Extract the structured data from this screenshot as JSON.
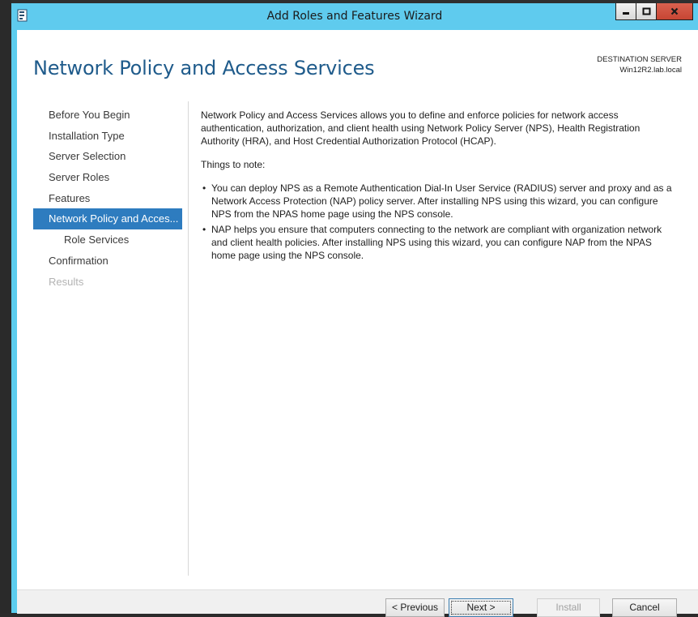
{
  "window": {
    "title": "Add Roles and Features Wizard",
    "buttons": {
      "minimize": "minimize-icon",
      "maximize": "maximize-icon",
      "close": "close-icon"
    }
  },
  "header": {
    "page_title": "Network Policy and Access Services",
    "destination_label": "DESTINATION SERVER",
    "destination_server": "Win12R2.lab.local"
  },
  "nav": {
    "items": [
      {
        "label": "Before You Begin",
        "state": "normal"
      },
      {
        "label": "Installation Type",
        "state": "normal"
      },
      {
        "label": "Server Selection",
        "state": "normal"
      },
      {
        "label": "Server Roles",
        "state": "normal"
      },
      {
        "label": "Features",
        "state": "normal"
      },
      {
        "label": "Network Policy and Acces...",
        "state": "active"
      },
      {
        "label": "Role Services",
        "state": "sub"
      },
      {
        "label": "Confirmation",
        "state": "normal"
      },
      {
        "label": "Results",
        "state": "disabled"
      }
    ]
  },
  "content": {
    "intro": "Network Policy and Access Services allows you to define and enforce policies for network access authentication, authorization, and client health using Network Policy Server (NPS), Health Registration Authority (HRA), and Host Credential Authorization Protocol (HCAP).",
    "notes_heading": "Things to note:",
    "bullet_glyph": "•",
    "bullets": [
      "You can deploy NPS as a Remote Authentication Dial-In User Service (RADIUS) server and proxy and as a Network Access Protection (NAP) policy server. After installing NPS using this wizard, you can configure NPS from the NPAS home page using the NPS console.",
      "NAP helps you ensure that computers connecting to the network are compliant with organization network and client health policies. After installing NPS using this wizard, you can configure NAP from the NPAS home page using the NPS console."
    ]
  },
  "footer": {
    "previous": "< Previous",
    "next": "Next >",
    "install": "Install",
    "cancel": "Cancel"
  },
  "colors": {
    "titlebar": "#5fcbee",
    "title_text": "#1f5b8b",
    "nav_active": "#2e7cbf",
    "close_button": "#c74634"
  }
}
